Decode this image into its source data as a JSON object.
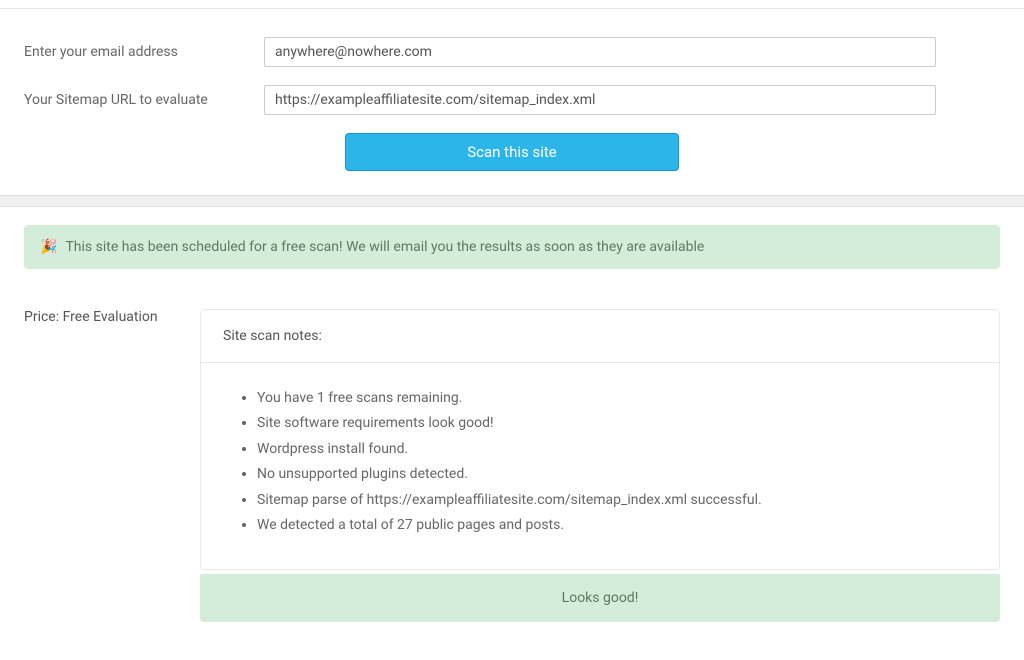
{
  "form": {
    "email_label": "Enter your email address",
    "email_value": "anywhere@nowhere.com",
    "sitemap_label": "Your Sitemap URL to evaluate",
    "sitemap_value": "https://exampleaffiliatesite.com/sitemap_index.xml",
    "scan_button": "Scan this site"
  },
  "alert": {
    "icon": "🎉",
    "message": "This site has been scheduled for a free scan! We will email you the results as soon as they are available"
  },
  "price_label": "Price: Free Evaluation",
  "notes": {
    "header": "Site scan notes:",
    "items": [
      "You have 1 free scans remaining.",
      "Site software requirements look good!",
      "Wordpress install found.",
      "No unsupported plugins detected.",
      "Sitemap parse of https://exampleaffiliatesite.com/sitemap_index.xml successful.",
      "We detected a total of 27 public pages and posts."
    ],
    "footer": "Looks good!"
  }
}
